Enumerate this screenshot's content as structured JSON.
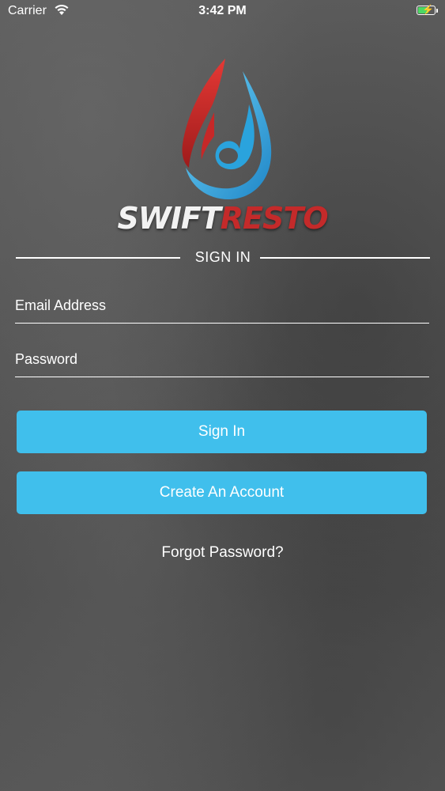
{
  "status_bar": {
    "carrier": "Carrier",
    "time": "3:42 PM",
    "battery_level": 0.6,
    "icons": [
      "wifi-icon",
      "battery-charging-icon"
    ]
  },
  "logo": {
    "brand_first": "SWIFT",
    "brand_second": "RESTO",
    "colors": {
      "red": "#c42a2a",
      "blue": "#3fa9e0",
      "white": "#f2f2f2"
    }
  },
  "signin": {
    "section_title": "SIGN IN",
    "email_placeholder": "Email Address",
    "email_value": "",
    "password_placeholder": "Password",
    "password_value": "",
    "sign_in_label": "Sign In",
    "create_account_label": "Create An Account",
    "forgot_password_label": "Forgot Password?"
  },
  "colors": {
    "accent": "#40bfec",
    "background": "#555555",
    "text": "#ffffff"
  }
}
